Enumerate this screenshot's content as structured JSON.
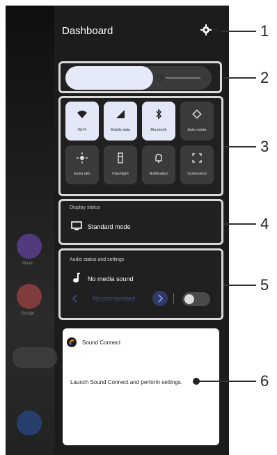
{
  "dashboard": {
    "title": "Dashboard"
  },
  "brightness": {
    "level": 0.6
  },
  "tiles": [
    {
      "label": "Wi-Fi",
      "icon": "wifi-icon",
      "on": true
    },
    {
      "label": "Mobile data",
      "icon": "mobile-data-icon",
      "on": true
    },
    {
      "label": "Bluetooth",
      "icon": "bluetooth-icon",
      "on": true
    },
    {
      "label": "Auto-rotate",
      "icon": "rotate-icon",
      "on": false
    },
    {
      "label": "Extra dim",
      "icon": "extra-dim-icon",
      "on": false
    },
    {
      "label": "Flashlight",
      "icon": "flashlight-icon",
      "on": false
    },
    {
      "label": "Notification",
      "icon": "bell-icon",
      "on": false
    },
    {
      "label": "Screenshot",
      "icon": "screenshot-icon",
      "on": false
    }
  ],
  "display_status": {
    "heading": "Display status",
    "mode": "Standard mode"
  },
  "audio": {
    "heading": "Audio status and settings",
    "status": "No media sound",
    "preset": "Recommended",
    "toggle_on": false
  },
  "sound_connect": {
    "title": "Sound Connect",
    "description": "Launch Sound Connect and perform settings."
  },
  "wallpaper": {
    "app_label_1": "Music",
    "app_label_2": "Google"
  },
  "callouts": [
    "1",
    "2",
    "3",
    "4",
    "5",
    "6"
  ],
  "colors": {
    "panel": "#202020",
    "tile_on": "#e4e7f6",
    "tile_off": "#3b3b3b",
    "highlight": "#d9d9d9"
  }
}
